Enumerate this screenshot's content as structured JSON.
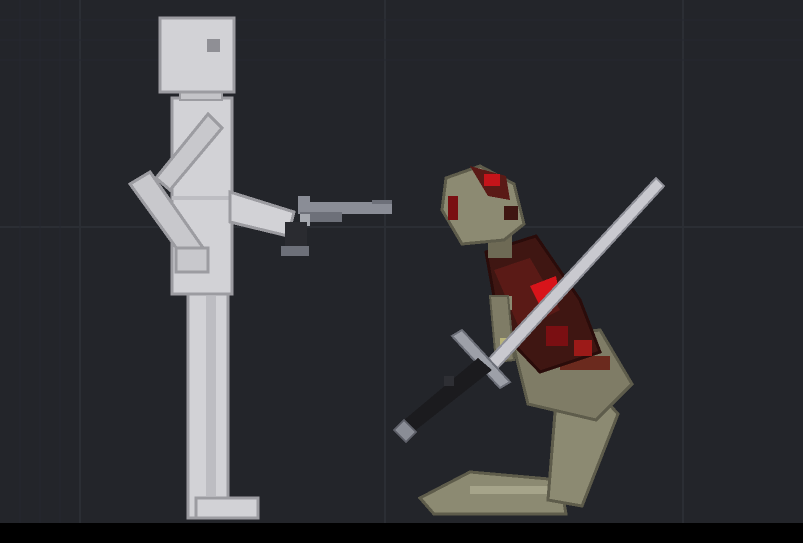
{
  "scene": {
    "background_color": "#23252a",
    "grid_color": "#2b2e34",
    "floor_color": "#000000"
  },
  "characters": [
    {
      "id": "human",
      "skin_color": "#d2d2d6",
      "shadow_color": "#a9a9ad",
      "outline_color": "#8a8a8f"
    },
    {
      "id": "android",
      "skin_color": "#8c8a72",
      "blood_color": "#7a0f12",
      "wound_color": "#d8141a"
    }
  ],
  "weapons": [
    {
      "name": "revolver-icon",
      "color": "#8a8d96",
      "grip_color": "#2a2b30"
    },
    {
      "name": "sword-icon",
      "blade_color": "#c9c9cf",
      "hilt_color": "#1b1b1e",
      "guard_color": "#9da0a8"
    }
  ]
}
